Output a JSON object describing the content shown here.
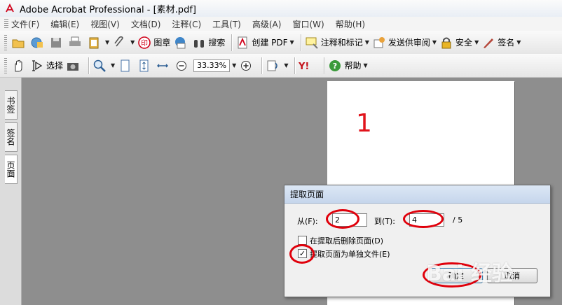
{
  "window": {
    "title": "Adobe Acrobat Professional - [素材.pdf]"
  },
  "menu": [
    "文件(F)",
    "编辑(E)",
    "视图(V)",
    "文档(D)",
    "注释(C)",
    "工具(T)",
    "高级(A)",
    "窗口(W)",
    "帮助(H)"
  ],
  "toolbar1": {
    "stamp": "图章",
    "search": "搜索",
    "create_pdf": "创建 PDF",
    "comment_markup": "注释和标记",
    "send_review": "发送供审阅",
    "security": "安全",
    "sign": "签名"
  },
  "toolbar2": {
    "select": "选择",
    "zoom_value": "33.33%",
    "help": "帮助"
  },
  "sidebar": {
    "tabs": [
      "书签",
      "签名",
      "页面"
    ]
  },
  "page": {
    "number": "1"
  },
  "dialog": {
    "title": "提取页面",
    "from_label": "从(F):",
    "from_value": "2",
    "to_label": "到(T):",
    "to_value": "4",
    "total": "/ 5",
    "delete_after": "在提取后删除页面(D)",
    "delete_after_checked": false,
    "separate_files": "提取页面为单独文件(E)",
    "separate_files_checked": true,
    "ok": "确定",
    "cancel": "取消"
  },
  "watermark": "Bai 经验",
  "colors": {
    "annotation_red": "#e0000b",
    "page_number_red": "#e1141c"
  }
}
